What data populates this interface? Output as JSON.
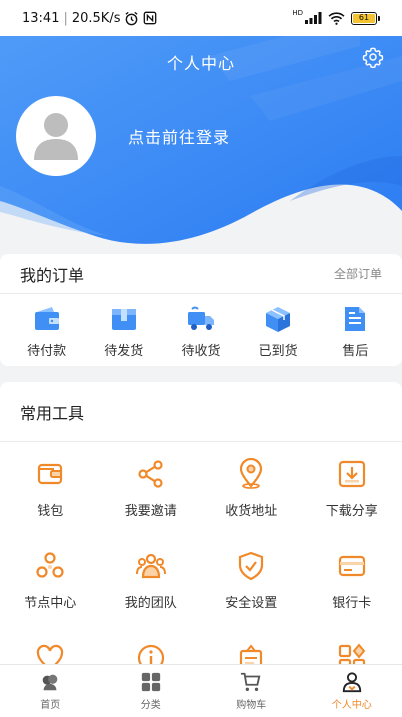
{
  "status_bar": {
    "time": "13:41",
    "speed": "20.5K/s",
    "battery": "61",
    "signal_tag": "HD"
  },
  "header": {
    "title": "个人中心",
    "login_prompt": "点击前往登录"
  },
  "orders": {
    "title": "我的订单",
    "all_link": "全部订单",
    "items": [
      {
        "label": "待付款",
        "icon": "wallet-icon"
      },
      {
        "label": "待发货",
        "icon": "package-box-icon"
      },
      {
        "label": "待收货",
        "icon": "delivery-truck-icon"
      },
      {
        "label": "已到货",
        "icon": "arrived-box-icon"
      },
      {
        "label": "售后",
        "icon": "after-sales-document-icon"
      }
    ]
  },
  "tools": {
    "title": "常用工具",
    "items": [
      {
        "label": "钱包",
        "icon": "wallet-icon"
      },
      {
        "label": "我要邀请",
        "icon": "share-icon"
      },
      {
        "label": "收货地址",
        "icon": "location-pin-icon"
      },
      {
        "label": "下载分享",
        "icon": "download-icon"
      },
      {
        "label": "节点中心",
        "icon": "nodes-icon"
      },
      {
        "label": "我的团队",
        "icon": "team-icon"
      },
      {
        "label": "安全设置",
        "icon": "shield-icon"
      },
      {
        "label": "银行卡",
        "icon": "bank-card-icon"
      },
      {
        "label": "",
        "icon": "heart-icon"
      },
      {
        "label": "",
        "icon": "info-icon"
      },
      {
        "label": "",
        "icon": "notice-board-icon"
      },
      {
        "label": "",
        "icon": "apps-grid-icon"
      }
    ]
  },
  "tabbar": {
    "items": [
      {
        "label": "首页",
        "icon": "home-icon"
      },
      {
        "label": "分类",
        "icon": "category-icon"
      },
      {
        "label": "购物车",
        "icon": "cart-icon"
      },
      {
        "label": "个人中心",
        "icon": "user-icon",
        "active": true
      }
    ]
  },
  "colors": {
    "brand_blue": "#3e8ef7",
    "accent_orange": "#f0892a",
    "background": "#f2f3f5"
  }
}
